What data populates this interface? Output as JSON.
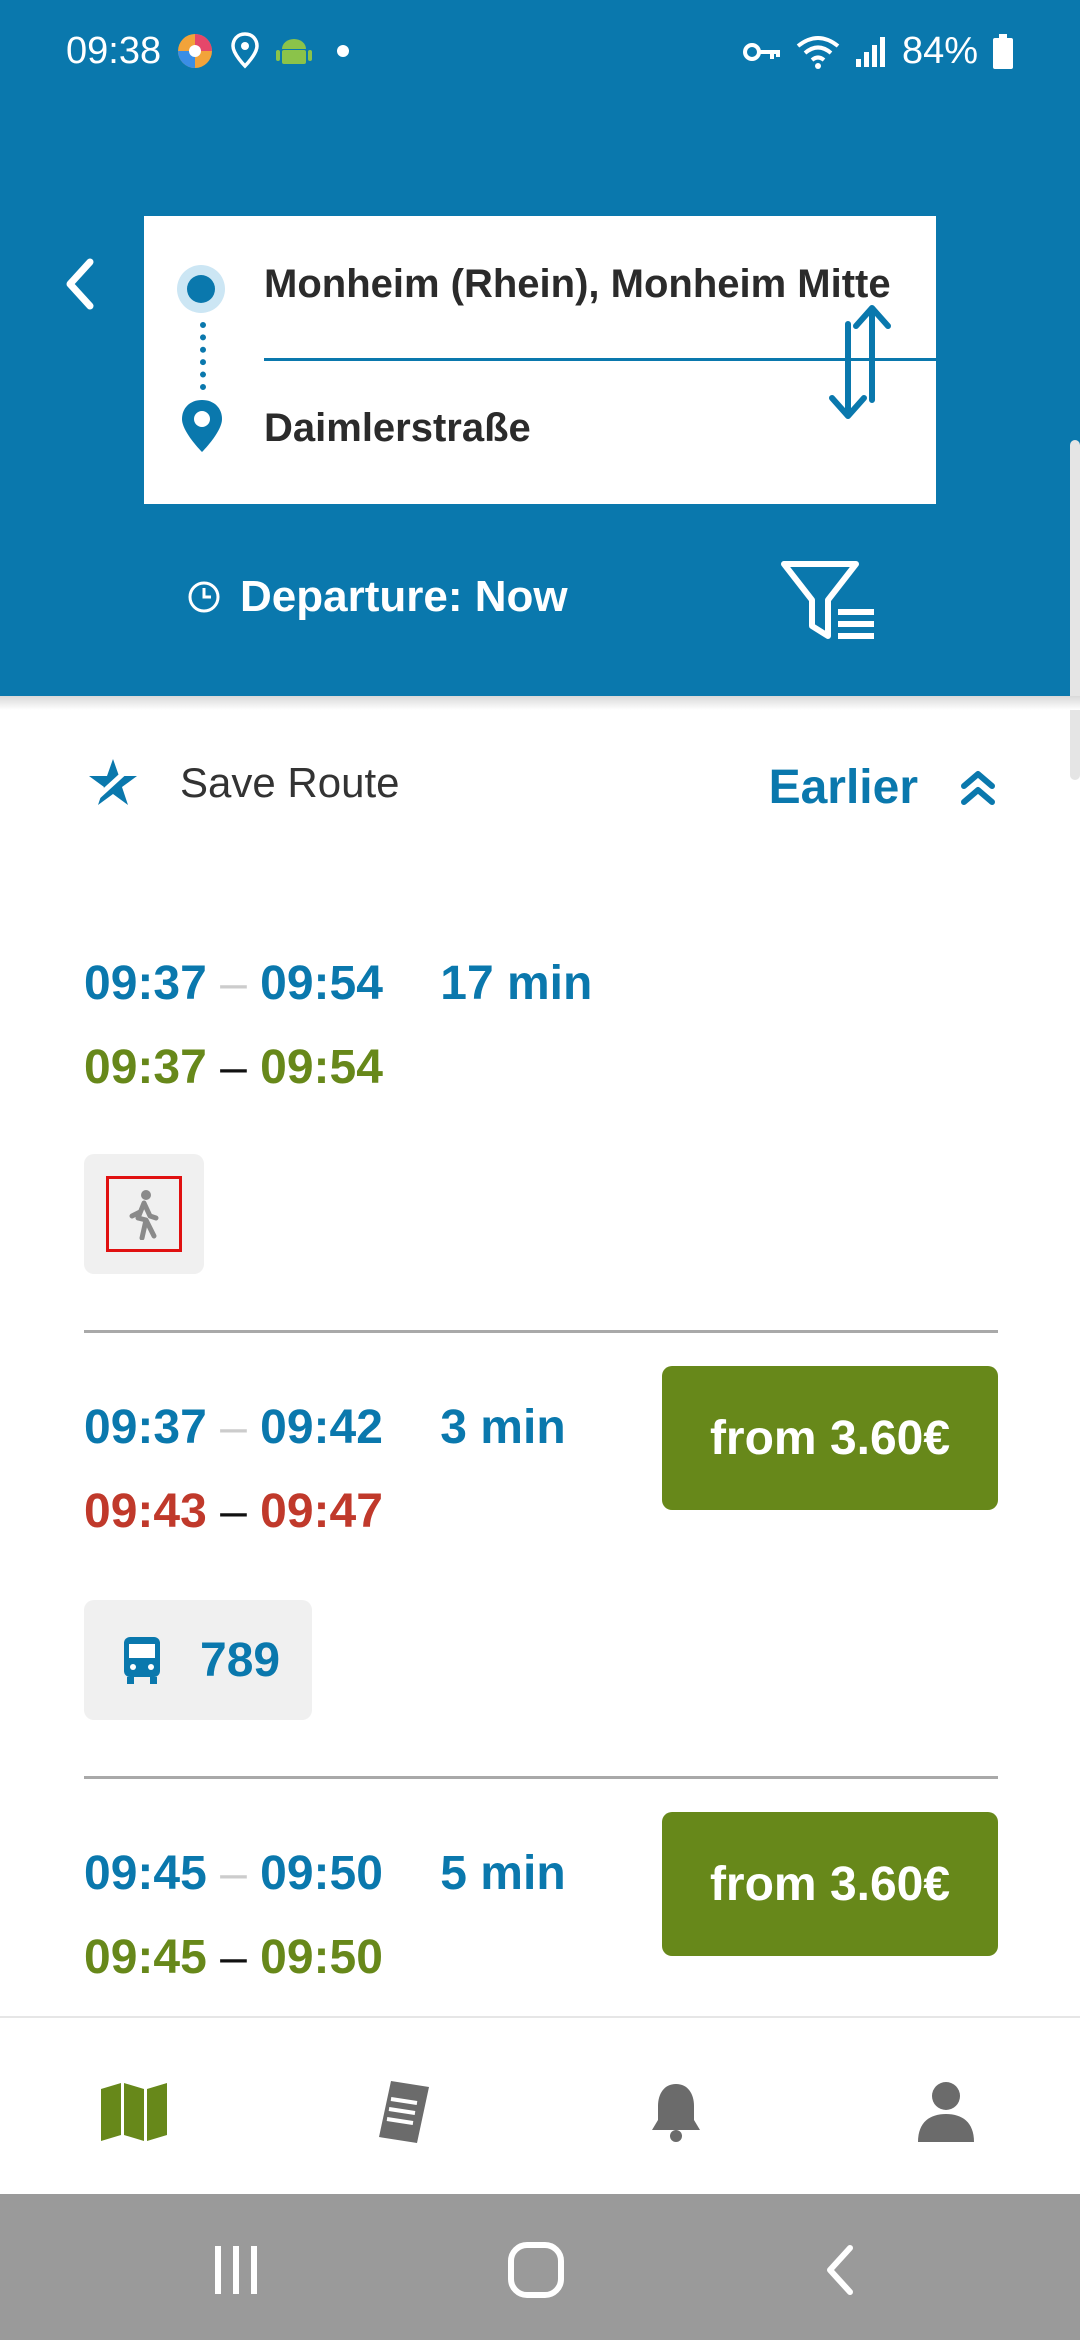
{
  "status_bar": {
    "time": "09:38",
    "battery": "84%"
  },
  "search": {
    "origin": "Monheim (Rhein), Monheim Mitte",
    "destination": "Daimlerstraße",
    "departure_label": "Departure: Now"
  },
  "actions": {
    "save_route": "Save Route",
    "earlier": "Earlier"
  },
  "trips": [
    {
      "planned_start": "09:37",
      "planned_end": "09:54",
      "duration": "17 min",
      "actual_start": "09:37",
      "actual_end": "09:54",
      "actual_color": "#67881a",
      "modes": [
        {
          "icon": "walk-icon"
        }
      ],
      "price": ""
    },
    {
      "planned_start": "09:37",
      "planned_end": "09:42",
      "duration": "3 min",
      "actual_start": "09:43",
      "actual_end": "09:47",
      "actual_color": "#c0392b",
      "modes": [
        {
          "icon": "bus-icon",
          "line": "789"
        }
      ],
      "price": "from 3.60€"
    },
    {
      "planned_start": "09:45",
      "planned_end": "09:50",
      "duration": "5 min",
      "actual_start": "09:45",
      "actual_end": "09:50",
      "actual_color": "#67881a",
      "modes": [],
      "price": "from 3.60€"
    }
  ],
  "separators": {
    "dash": "–"
  },
  "bottom_nav": [
    "map-icon",
    "ticket-icon",
    "bell-icon",
    "profile-icon"
  ],
  "colors": {
    "primary": "#0a78ad",
    "accent_green": "#67881a",
    "delay_red": "#c0392b"
  }
}
